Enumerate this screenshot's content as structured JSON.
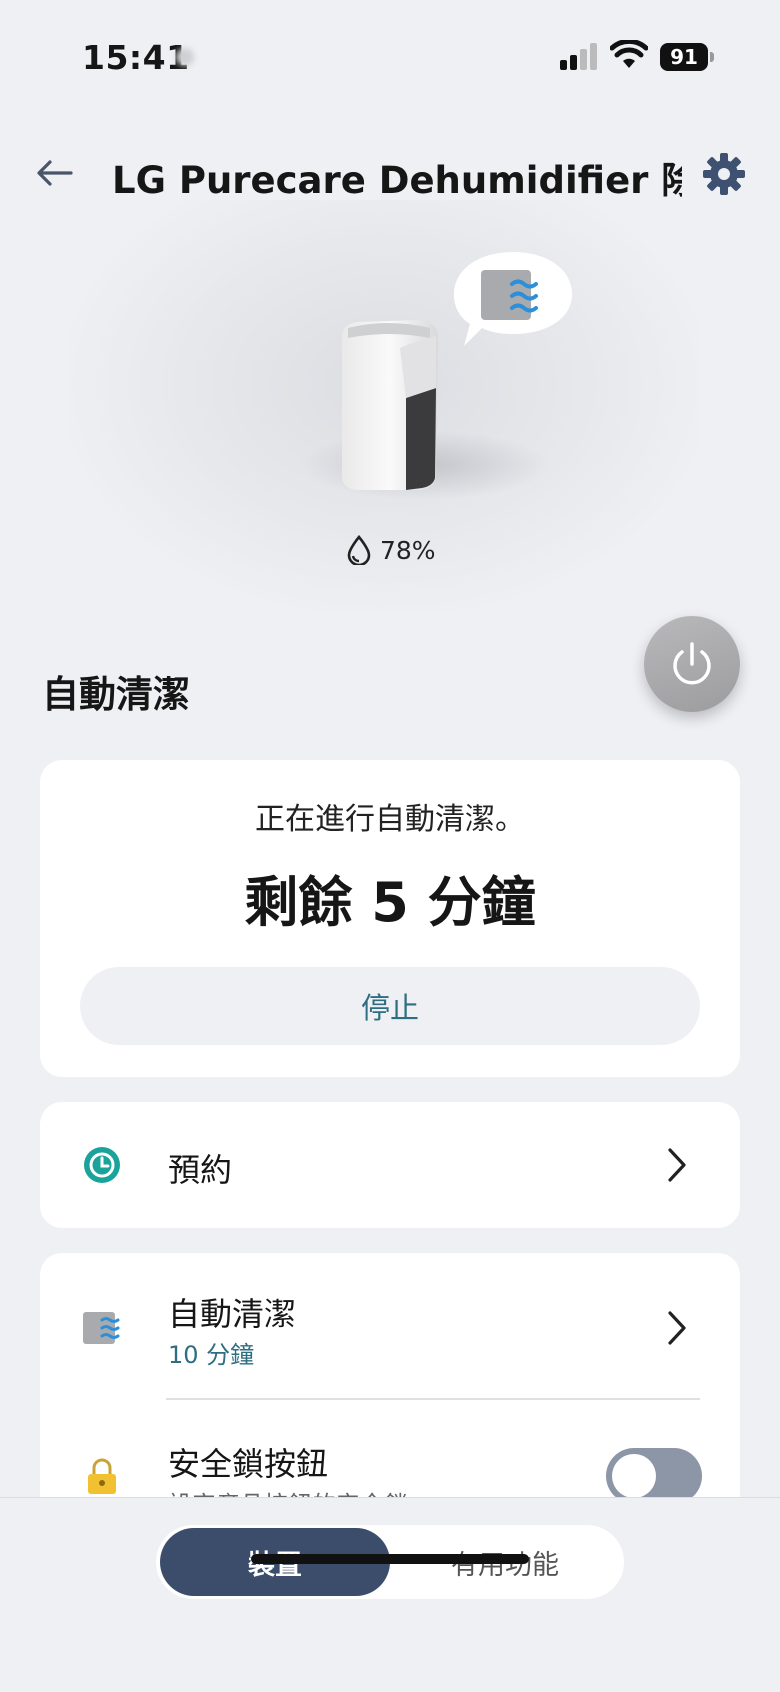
{
  "status_bar": {
    "time": "15:41",
    "battery": "91"
  },
  "header": {
    "title": "LG Purecare Dehumidifier 除..."
  },
  "hero": {
    "humidity": "78%"
  },
  "section": {
    "title": "自動清潔"
  },
  "status_card": {
    "message": "正在進行自動清潔。",
    "remaining": "剩餘 5 分鐘",
    "stop_label": "停止"
  },
  "schedule": {
    "label": "預約"
  },
  "settings": {
    "auto_clean_label": "自動清潔",
    "auto_clean_value": "10 分鐘",
    "safety_lock_label": "安全鎖按鈕",
    "safety_lock_desc": "設定產品按鈕的安全鎖。",
    "safety_lock_on": false
  },
  "tabs": [
    {
      "label": "裝置",
      "active": true
    },
    {
      "label": "有用功能",
      "active": false
    }
  ],
  "colors": {
    "accent": "#2e6d82",
    "teal": "#1aa39a",
    "tab_active": "#3c4d6b"
  }
}
